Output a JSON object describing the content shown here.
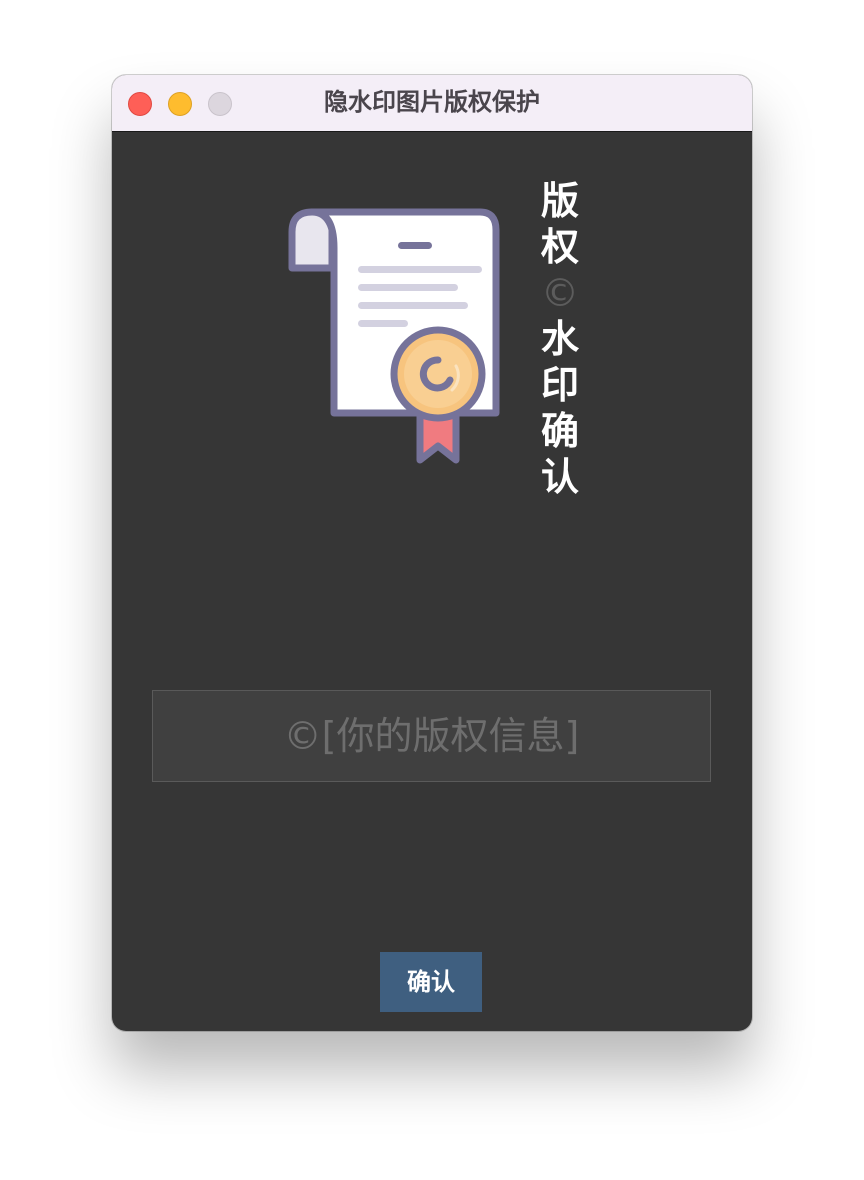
{
  "window": {
    "title": "隐水印图片版权保护"
  },
  "main": {
    "vertical_title": [
      "版",
      "权",
      "©",
      "水",
      "印",
      "确",
      "认"
    ],
    "icon": "certificate-scroll-icon",
    "copyright_field": {
      "value": "©[你的版权信息]"
    },
    "confirm_label": "确认"
  },
  "colors": {
    "window_background": "#363636",
    "titlebar_background": "#f4eef7",
    "button_background": "#3f5f80",
    "close": "#fe5f57",
    "minimize": "#febc2e",
    "zoom": "#dcd6de"
  }
}
